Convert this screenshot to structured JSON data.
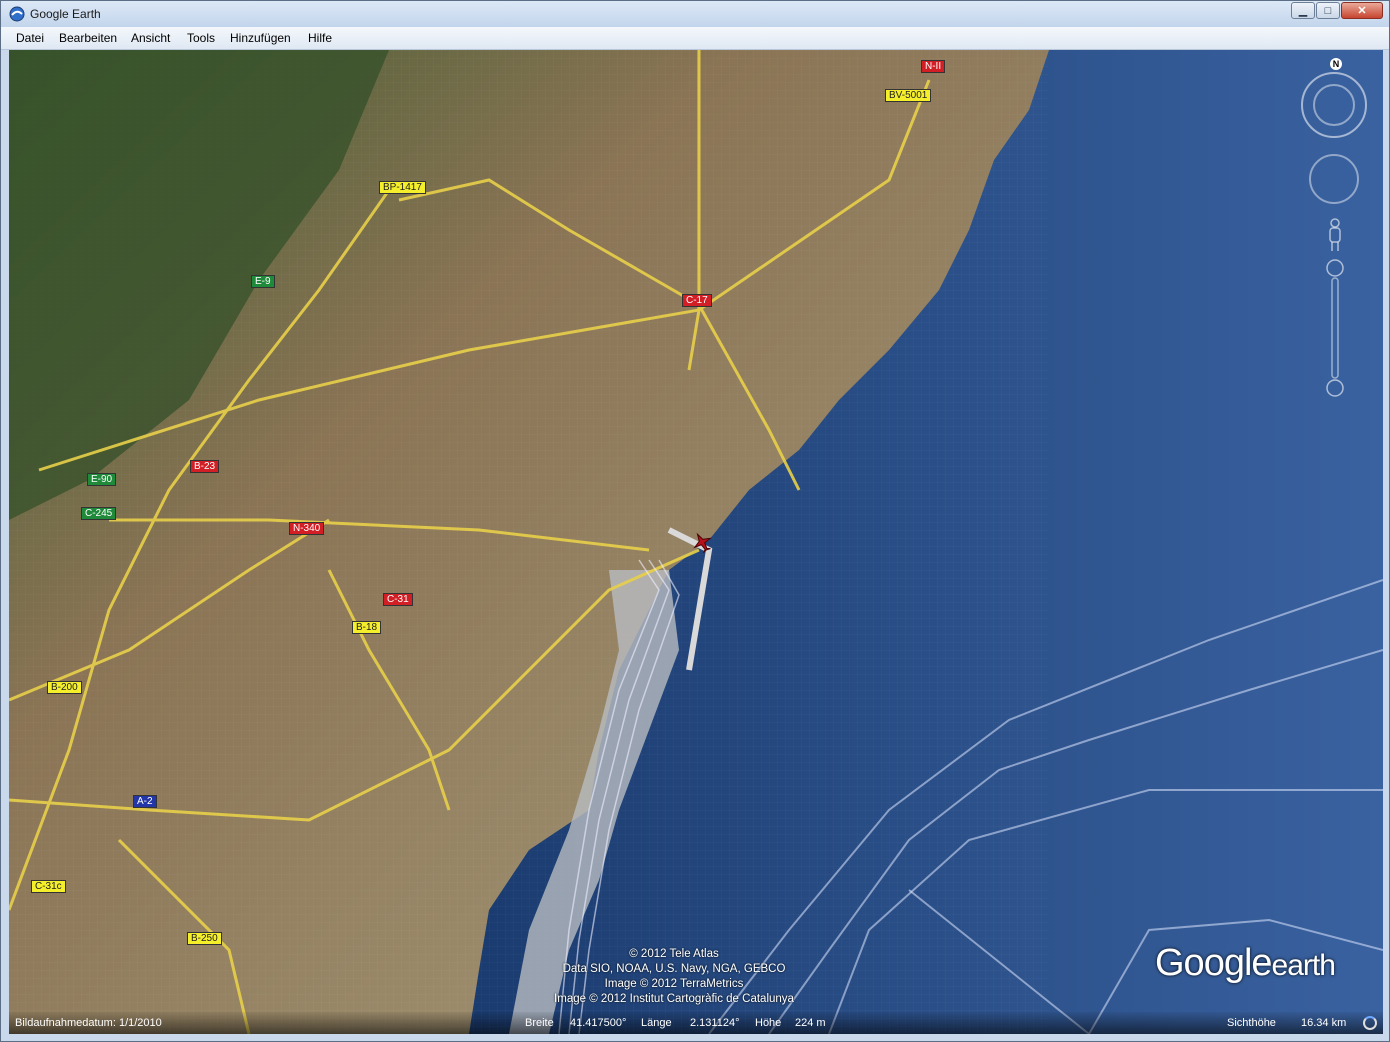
{
  "window": {
    "title": "Google Earth"
  },
  "window_controls": {
    "minimize": "▁",
    "maximize": "□",
    "close": "✕"
  },
  "menu": [
    {
      "label": "Datei"
    },
    {
      "label": "Bearbeiten"
    },
    {
      "label": "Ansicht"
    },
    {
      "label": "Tools"
    },
    {
      "label": "Hinzufügen"
    },
    {
      "label": "Hilfe"
    }
  ],
  "map": {
    "road_labels": [
      {
        "text": "N-II",
        "color": "red"
      },
      {
        "text": "BV-5001",
        "color": "yellow"
      },
      {
        "text": "BP-1417",
        "color": "yellow"
      },
      {
        "text": "E-9",
        "color": "green"
      },
      {
        "text": "C-17",
        "color": "red"
      },
      {
        "text": "B-23",
        "color": "red"
      },
      {
        "text": "E-90",
        "color": "green"
      },
      {
        "text": "C-245",
        "color": "green"
      },
      {
        "text": "N-340",
        "color": "red"
      },
      {
        "text": "C-31",
        "color": "red"
      },
      {
        "text": "B-18",
        "color": "yellow"
      },
      {
        "text": "B-200",
        "color": "yellow"
      },
      {
        "text": "A-2",
        "color": "blue"
      },
      {
        "text": "C-31c",
        "color": "yellow"
      },
      {
        "text": "B-250",
        "color": "yellow"
      }
    ],
    "compass_north": "N",
    "attribution": [
      "© 2012 Tele Atlas",
      "Data SIO, NOAA, U.S. Navy, NGA, GEBCO",
      "Image © 2012 TerraMetrics",
      "Image © 2012 Institut Cartogràfic de Catalunya"
    ],
    "logo": {
      "google": "Google",
      "earth": "earth"
    }
  },
  "status": {
    "imagery_date_label": "Bildaufnahmedatum: 1/1/2010",
    "lat_label": "Breite",
    "lat_value": "41.417500°",
    "lon_label": "Länge",
    "lon_value": "2.131124°",
    "elev_label": "Höhe",
    "elev_value": "224 m",
    "eye_alt_label": "Sichthöhe",
    "eye_alt_value": "16.34 km"
  },
  "colors": {
    "sea": "#1d3f72",
    "land": "#8a7a55",
    "road": "#e8d04a"
  }
}
